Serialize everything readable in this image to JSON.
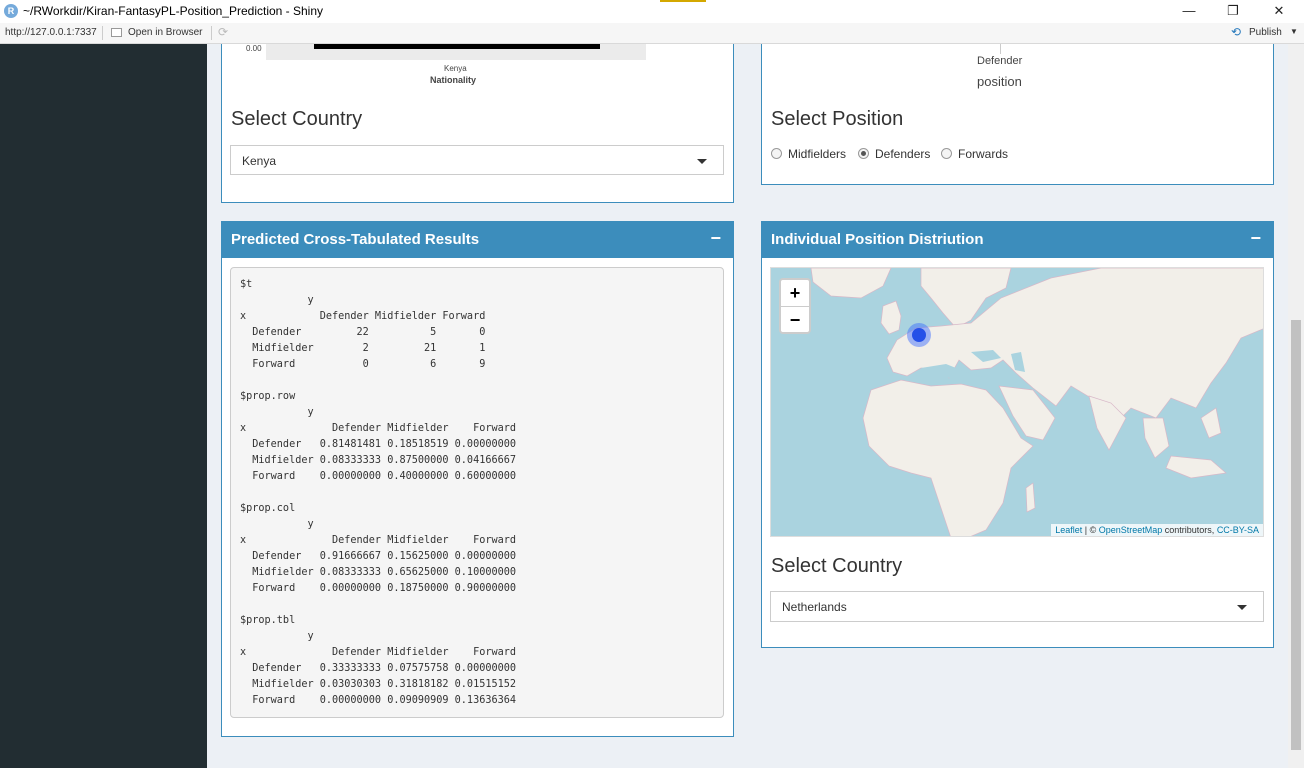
{
  "window": {
    "title": "~/RWorkdir/Kiran-FantasyPL-Position_Prediction - Shiny",
    "app_icon_letter": "R",
    "minimize": "—",
    "maximize": "❐",
    "close": "✕"
  },
  "address_bar": {
    "url": "http://127.0.0.1:7337",
    "open_in_browser": "Open in Browser",
    "publish": "Publish"
  },
  "country_plot": {
    "y_tick": "0.00",
    "x_tick": "Kenya",
    "xlabel": "Nationality"
  },
  "country_select": {
    "label": "Select Country",
    "value": "Kenya"
  },
  "position_plot": {
    "x_tick": "Defender",
    "xlabel": "position"
  },
  "position_select": {
    "label": "Select Position",
    "options": [
      "Midfielders",
      "Defenders",
      "Forwards"
    ],
    "selected": "Defenders"
  },
  "crosstab_box": {
    "title": "Predicted Cross-Tabulated Results",
    "collapse": "−",
    "output": "$t\n           y\nx            Defender Midfielder Forward\n  Defender         22          5       0\n  Midfielder        2         21       1\n  Forward           0          6       9\n\n$prop.row\n           y\nx              Defender Midfielder    Forward\n  Defender   0.81481481 0.18518519 0.00000000\n  Midfielder 0.08333333 0.87500000 0.04166667\n  Forward    0.00000000 0.40000000 0.60000000\n\n$prop.col\n           y\nx              Defender Midfielder    Forward\n  Defender   0.91666667 0.15625000 0.00000000\n  Midfielder 0.08333333 0.65625000 0.10000000\n  Forward    0.00000000 0.18750000 0.90000000\n\n$prop.tbl\n           y\nx              Defender Midfielder    Forward\n  Defender   0.33333333 0.07575758 0.00000000\n  Midfielder 0.03030303 0.31818182 0.01515152\n  Forward    0.00000000 0.09090909 0.13636364"
  },
  "map_box": {
    "title": "Individual Position Distriution",
    "collapse": "−",
    "zoom_in": "+",
    "zoom_out": "−",
    "attribution_leaflet": "Leaflet",
    "attribution_sep": " | © ",
    "attribution_osm": "OpenStreetMap",
    "attribution_contrib": " contributors, ",
    "attribution_license": "CC-BY-SA",
    "country_label": "Select Country",
    "country_value": "Netherlands"
  },
  "colors": {
    "header_blue": "#3c8dbc",
    "sidebar": "#222d32",
    "background": "#ecf0f5",
    "map_water": "#aad3df",
    "map_land": "#f2efe9",
    "marker": "#2550e8"
  }
}
